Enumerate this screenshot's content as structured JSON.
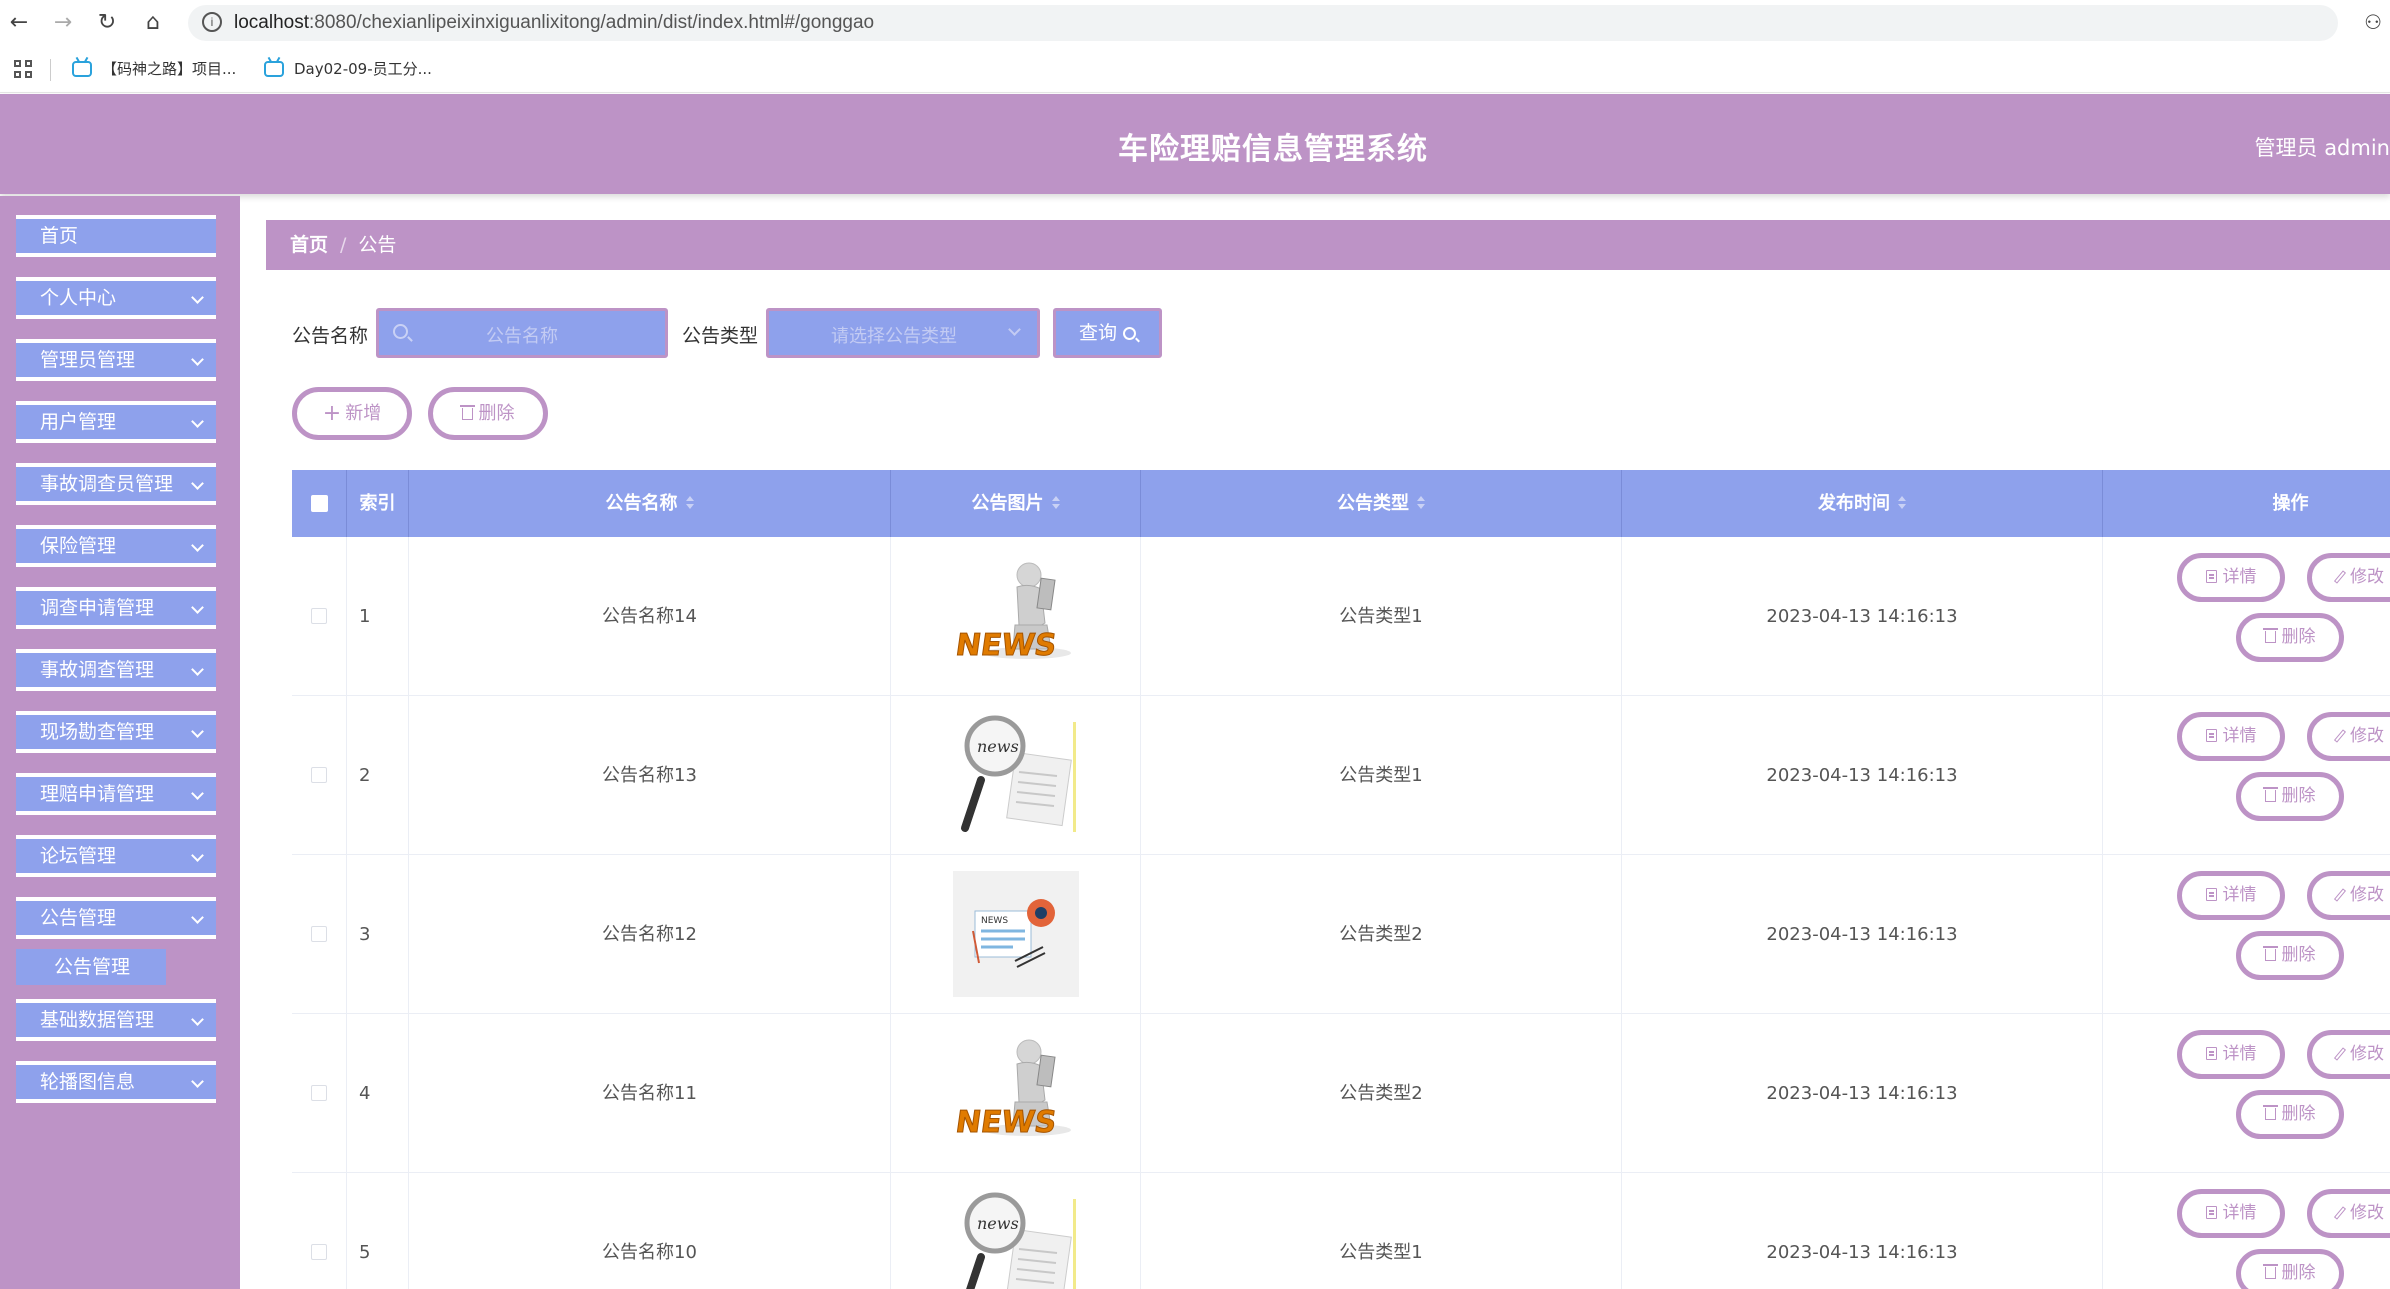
{
  "browser": {
    "url_host": "localhost",
    "url_rest": ":8080/chexianlipeixinxiguanlixitong/admin/dist/index.html#/gonggao",
    "bookmarks": [
      "【码神之路】项目...",
      "Day02-09-员工分..."
    ]
  },
  "header": {
    "title": "车险理赔信息管理系统",
    "user": "管理员 admin"
  },
  "sidebar": {
    "items": [
      {
        "label": "首页",
        "expandable": false
      },
      {
        "label": "个人中心",
        "expandable": true
      },
      {
        "label": "管理员管理",
        "expandable": true
      },
      {
        "label": "用户管理",
        "expandable": true
      },
      {
        "label": "事故调查员管理",
        "expandable": true
      },
      {
        "label": "保险管理",
        "expandable": true
      },
      {
        "label": "调查申请管理",
        "expandable": true
      },
      {
        "label": "事故调查管理",
        "expandable": true
      },
      {
        "label": "现场勘查管理",
        "expandable": true
      },
      {
        "label": "理赔申请管理",
        "expandable": true
      },
      {
        "label": "论坛管理",
        "expandable": true
      },
      {
        "label": "公告管理",
        "expandable": true
      },
      {
        "label": "基础数据管理",
        "expandable": true
      },
      {
        "label": "轮播图信息",
        "expandable": true
      }
    ],
    "submenu": {
      "label": "公告管理"
    }
  },
  "breadcrumb": {
    "home": "首页",
    "separator": "/",
    "current": "公告"
  },
  "search": {
    "name_label": "公告名称",
    "name_placeholder": "公告名称",
    "type_label": "公告类型",
    "type_placeholder": "请选择公告类型",
    "query_label": "查询"
  },
  "actions": {
    "add_label": "新增",
    "delete_label": "删除"
  },
  "table": {
    "columns": [
      "索引",
      "公告名称",
      "公告图片",
      "公告类型",
      "发布时间",
      "操作"
    ],
    "rows": [
      {
        "index": "1",
        "name": "公告名称14",
        "image": "news-figure",
        "type": "公告类型1",
        "time": "2023-04-13 14:16:13"
      },
      {
        "index": "2",
        "name": "公告名称13",
        "image": "news-magnifier",
        "type": "公告类型1",
        "time": "2023-04-13 14:16:13"
      },
      {
        "index": "3",
        "name": "公告名称12",
        "image": "news-paper",
        "type": "公告类型2",
        "time": "2023-04-13 14:16:13"
      },
      {
        "index": "4",
        "name": "公告名称11",
        "image": "news-figure",
        "type": "公告类型2",
        "time": "2023-04-13 14:16:13"
      },
      {
        "index": "5",
        "name": "公告名称10",
        "image": "news-magnifier",
        "type": "公告类型1",
        "time": "2023-04-13 14:16:13"
      }
    ],
    "row_actions": {
      "detail": "详情",
      "edit": "修改",
      "delete": "删除"
    }
  },
  "images": {
    "news_text": "NEWS",
    "news_text_small": "news"
  },
  "colors": {
    "accent": "#bd93c6",
    "primary": "#8ea1ec"
  }
}
